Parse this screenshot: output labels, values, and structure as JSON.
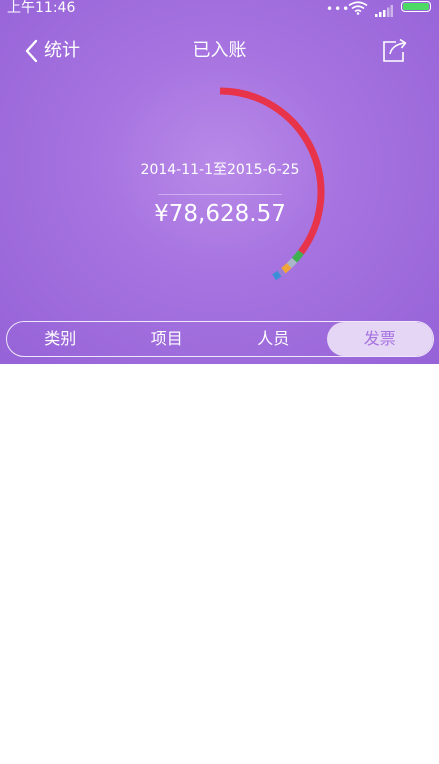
{
  "status_bar": {
    "time": "上午11:46",
    "dots": "•••",
    "battery_color": "#4cd964"
  },
  "header": {
    "back_label": "统计",
    "back_icon": "chevron-left-icon",
    "title": "已入账",
    "share_icon": "share-icon"
  },
  "summary": {
    "date_range": "2014-11-1至2015-6-25",
    "amount": "¥78,628.57"
  },
  "ring_segments": [
    {
      "color": "#e8344a",
      "fraction": 0.352
    },
    {
      "color": "#3fb14f",
      "fraction": 0.016
    },
    {
      "color": "#a9b7c9",
      "fraction": 0.012
    },
    {
      "color": "#f0a63a",
      "fraction": 0.012
    },
    {
      "color": "#9b7fd6",
      "fraction": 0.008
    },
    {
      "color": "#3a8fd8",
      "fraction": 0.01
    }
  ],
  "tabs": [
    {
      "label": "类别",
      "active": false
    },
    {
      "label": "项目",
      "active": false
    },
    {
      "label": "人员",
      "active": false
    },
    {
      "label": "发票",
      "active": true
    }
  ],
  "colors": {
    "hero_bg": "#a673e0",
    "tab_active_bg": "#e5d6f6",
    "tab_active_text": "#a673e0"
  }
}
